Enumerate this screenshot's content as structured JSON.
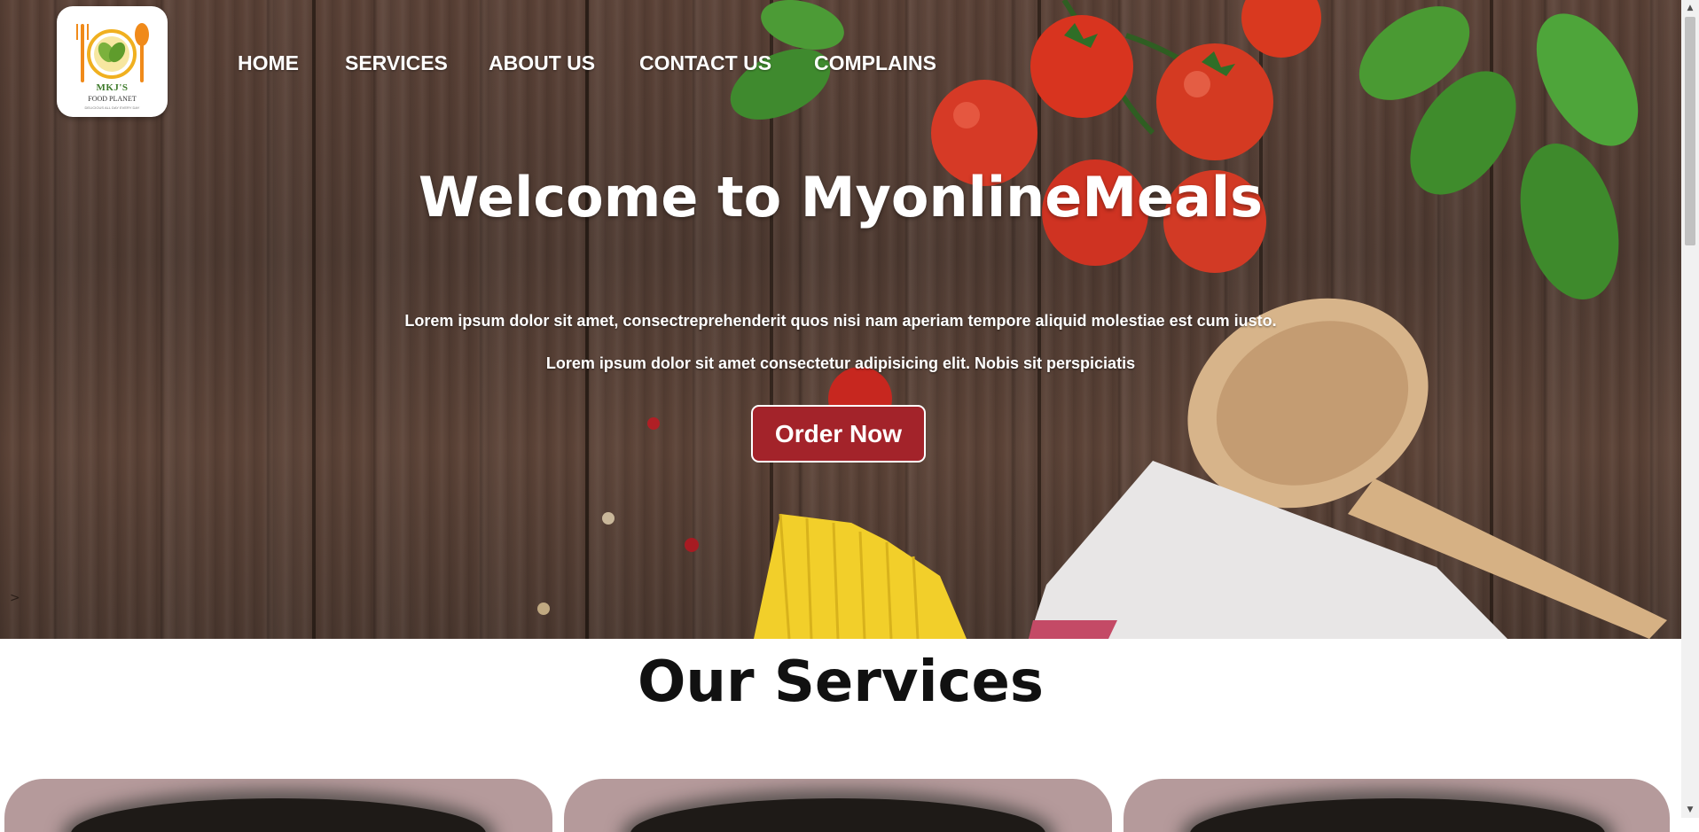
{
  "logo": {
    "brand": "MKJ'S",
    "subtitle": "FOOD PLANET",
    "tagline": "DELICIOUS ALL DAY EVERY DAY"
  },
  "nav": [
    {
      "label": "HOME"
    },
    {
      "label": "SERVICES"
    },
    {
      "label": "ABOUT US"
    },
    {
      "label": "CONTACT US"
    },
    {
      "label": "COMPLAINS"
    }
  ],
  "hero": {
    "title": "Welcome to MyonlineMeals",
    "line1": "Lorem ipsum dolor sit amet, consectreprehenderit quos nisi nam aperiam tempore aliquid molestiae est cum iusto.",
    "line2": "Lorem ipsum dolor sit amet consectetur adipisicing elit. Nobis sit perspiciatis",
    "cta": "Order Now",
    "slide_indicator": ">"
  },
  "services": {
    "title": "Our Services",
    "cards": [
      {
        "name": "service-card-1"
      },
      {
        "name": "service-card-2"
      },
      {
        "name": "service-card-3"
      }
    ]
  },
  "colors": {
    "accent": "#a3232a",
    "card": "#b59a9b",
    "wood": "#5a4136"
  },
  "icons": {
    "logo": "plate-fork-spoon-leaf-icon",
    "scroll_up": "triangle-up-icon",
    "scroll_down": "triangle-down-icon"
  }
}
